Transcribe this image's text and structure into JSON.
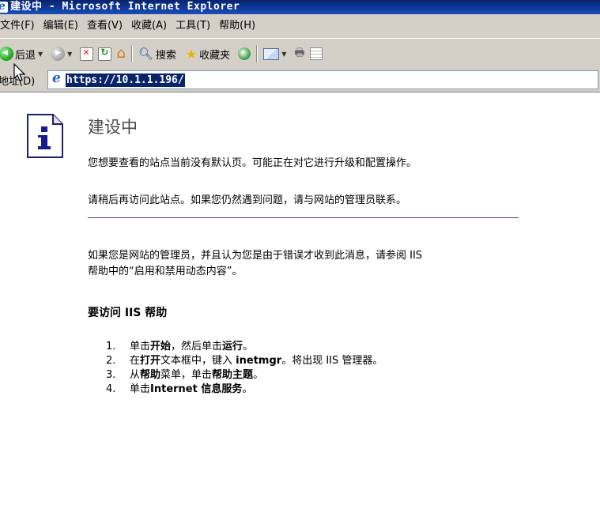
{
  "window": {
    "title": "建设中 - Microsoft Internet Explorer"
  },
  "menu": [
    "文件(F)",
    "编辑(E)",
    "查看(V)",
    "收藏(A)",
    "工具(T)",
    "帮助(H)"
  ],
  "toolbar": {
    "back_label": "后退",
    "search_label": "搜索",
    "favorites_label": "收藏夹"
  },
  "address": {
    "label": "地址(D)",
    "url": "https://10.1.1.196/"
  },
  "page": {
    "heading": "建设中",
    "para1": "您想要查看的站点当前没有默认页。可能正在对它进行升级和配置操作。",
    "para2": "请稍后再访问此站点。如果您仍然遇到问题，请与网站的管理员联系。",
    "para3_line1": "如果您是网站的管理员，并且认为您是由于错误才收到此消息，请参阅 IIS",
    "para3_line2": "帮助中的“启用和禁用动态内容”。",
    "help_title": "要访问 IIS 帮助",
    "steps": [
      {
        "num": "1.",
        "pre": "单击",
        "b1": "开始",
        "mid": "，然后单击",
        "b2": "运行",
        "post": "。"
      },
      {
        "num": "2.",
        "pre": "在",
        "b1": "打开",
        "mid": "文本框中，键入 ",
        "b2": "inetmgr",
        "post": "。将出现 IIS 管理器。"
      },
      {
        "num": "3.",
        "pre": "从",
        "b1": "帮助",
        "mid": "菜单，单击",
        "b2": "帮助主题",
        "post": "。"
      },
      {
        "num": "4.",
        "pre": "单击",
        "b1": "Internet 信息服务",
        "mid": "",
        "b2": "",
        "post": "。"
      }
    ]
  },
  "colors": {
    "titlebar": "#0a246a",
    "chrome": "#d4d0c8",
    "rule": "#4040b0"
  }
}
